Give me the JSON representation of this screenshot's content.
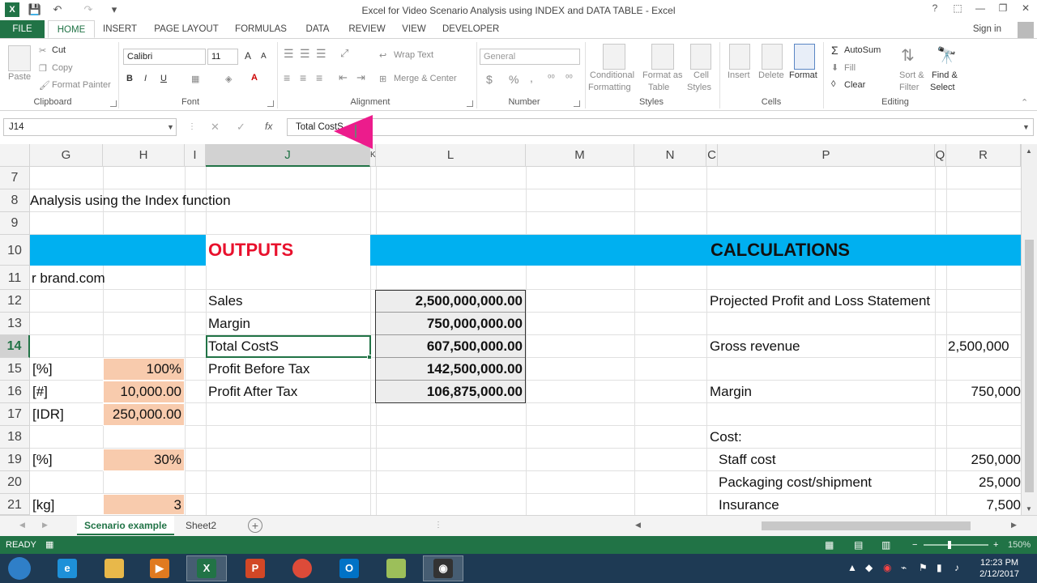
{
  "app": {
    "window_title": "Excel for Video Scenario Analysis using INDEX and DATA TABLE - Excel",
    "help": "?",
    "minimize": "—",
    "restore": "❐",
    "close": "✕"
  },
  "quick_access": {
    "excel_logo": "X",
    "save": "💾",
    "undo": "↶",
    "redo": "↷",
    "customize": "▾"
  },
  "ribbon_tabs": [
    "FILE",
    "HOME",
    "INSERT",
    "PAGE LAYOUT",
    "FORMULAS",
    "DATA",
    "REVIEW",
    "VIEW",
    "DEVELOPER"
  ],
  "active_tab": "HOME",
  "signin": "Sign in",
  "ribbon": {
    "clipboard": {
      "paste": "Paste",
      "cut": "Cut",
      "copy": "Copy",
      "format_painter": "Format Painter",
      "group": "Clipboard"
    },
    "font": {
      "name": "Calibri",
      "size": "11",
      "grow": "A",
      "shrink": "A",
      "bold": "B",
      "italic": "I",
      "underline": "U",
      "group": "Font"
    },
    "alignment": {
      "wrap_text": "Wrap Text",
      "merge_center": "Merge & Center",
      "group": "Alignment"
    },
    "number": {
      "format": "General",
      "currency": "$",
      "percent": "%",
      "comma": ",",
      "group": "Number"
    },
    "styles": {
      "conditional": "Conditional",
      "formatting": "Formatting",
      "format_as": "Format as",
      "table": "Table",
      "cell": "Cell",
      "styles_lbl": "Styles",
      "group": "Styles"
    },
    "cells": {
      "insert": "Insert",
      "delete": "Delete",
      "format": "Format",
      "group": "Cells"
    },
    "editing": {
      "autosum": "AutoSum",
      "fill": "Fill",
      "clear": "Clear",
      "sort": "Sort &",
      "filter": "Filter",
      "find": "Find &",
      "select": "Select",
      "group": "Editing"
    }
  },
  "formula_bar": {
    "name_box": "J14",
    "cancel": "✕",
    "enter": "✓",
    "fx": "fx",
    "content": "Total CostS"
  },
  "columns": [
    "G",
    "H",
    "I",
    "J",
    "K",
    "L",
    "M",
    "N",
    "C",
    "P",
    "Q",
    "R"
  ],
  "selected_column": "J",
  "rows": [
    "7",
    "8",
    "9",
    "10",
    "11",
    "12",
    "13",
    "14",
    "15",
    "16",
    "17",
    "18",
    "19",
    "20",
    "21"
  ],
  "selected_row": "14",
  "cells": {
    "g8": "Analysis using the Index function",
    "j10": "OUTPUTS",
    "p10": "CALCULATIONS",
    "g11": "r brand.com",
    "j12": "Sales",
    "l12": "2,500,000,000.00",
    "j13": "Margin",
    "l13": "750,000,000.00",
    "j14": "Total CostS",
    "l14": "607,500,000.00",
    "j15": "Profit Before Tax",
    "l15": "142,500,000.00",
    "j16": "Profit After Tax",
    "l16": "106,875,000.00",
    "g15": "[%]",
    "h15": "100%",
    "g16": "[#]",
    "h16": "10,000.00",
    "g17": "[IDR]",
    "h17": "250,000.00",
    "g19": "[%]",
    "h19": "30%",
    "g21": "[kg]",
    "h21": "3",
    "p12": "Projected Profit and Loss Statement",
    "p14": "Gross revenue",
    "r14": "2,500,000",
    "p16": "Margin",
    "r16": "750,000",
    "p18": "Cost:",
    "p19": "Staff cost",
    "r19": "250,000",
    "p20": "Packaging cost/shipment",
    "r20": "25,000",
    "p21": "Insurance",
    "r21": "7,500"
  },
  "sheets": [
    "Scenario example",
    "Sheet2"
  ],
  "active_sheet": "Scenario example",
  "add_sheet": "+",
  "status": {
    "ready": "READY",
    "zoom": "150%"
  },
  "taskbar": {
    "time": "12:23 PM",
    "date": "2/12/2017"
  },
  "colors": {
    "accent": "#217346",
    "band": "#00b0f0",
    "outputs_text": "#e8112d",
    "input_fill": "#f8cbad",
    "pointer": "#ec1c8c"
  }
}
